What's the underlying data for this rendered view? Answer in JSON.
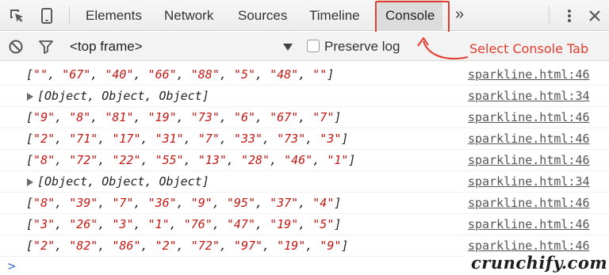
{
  "tabbar": {
    "tabs": [
      {
        "label": "Elements"
      },
      {
        "label": "Network"
      },
      {
        "label": "Sources"
      },
      {
        "label": "Timeline"
      },
      {
        "label": "Console",
        "active": true
      }
    ],
    "overflow_label": "»"
  },
  "toolbar": {
    "frame_select": "<top frame>",
    "preserve_log_label": "Preserve log",
    "preserve_log_checked": false
  },
  "annotation": {
    "text": "Select Console Tab",
    "color": "#e53b2c"
  },
  "console": {
    "rows": [
      {
        "kind": "array",
        "values": [
          "",
          "67",
          "40",
          "66",
          "88",
          "5",
          "48",
          ""
        ],
        "source": "sparkline.html:46"
      },
      {
        "kind": "object",
        "text": "[Object, Object, Object]",
        "source": "sparkline.html:34"
      },
      {
        "kind": "array",
        "values": [
          "9",
          "8",
          "81",
          "19",
          "73",
          "6",
          "67",
          "7"
        ],
        "source": "sparkline.html:46"
      },
      {
        "kind": "array",
        "values": [
          "2",
          "71",
          "17",
          "31",
          "7",
          "33",
          "73",
          "3"
        ],
        "source": "sparkline.html:46"
      },
      {
        "kind": "array",
        "values": [
          "8",
          "72",
          "22",
          "55",
          "13",
          "28",
          "46",
          "1"
        ],
        "source": "sparkline.html:46"
      },
      {
        "kind": "object",
        "text": "[Object, Object, Object]",
        "source": "sparkline.html:34"
      },
      {
        "kind": "array",
        "values": [
          "8",
          "39",
          "7",
          "36",
          "9",
          "95",
          "37",
          "4"
        ],
        "source": "sparkline.html:46"
      },
      {
        "kind": "array",
        "values": [
          "3",
          "26",
          "3",
          "1",
          "76",
          "47",
          "19",
          "5"
        ],
        "source": "sparkline.html:46"
      },
      {
        "kind": "array",
        "values": [
          "2",
          "82",
          "86",
          "2",
          "72",
          "97",
          "19",
          "9"
        ],
        "source": "sparkline.html:46"
      }
    ],
    "prompt": ">"
  },
  "watermark": {
    "text": "crunchify.com"
  },
  "colors": {
    "string_red": "#c41a16",
    "highlight_red": "#e53b2c",
    "prompt_blue": "#2f6fd6"
  },
  "icons": [
    "inspect-element-icon",
    "device-mode-icon",
    "kebab-menu-icon",
    "close-icon",
    "clear-console-icon",
    "filter-icon",
    "dropdown-arrow-icon",
    "disclosure-triangle-icon"
  ]
}
